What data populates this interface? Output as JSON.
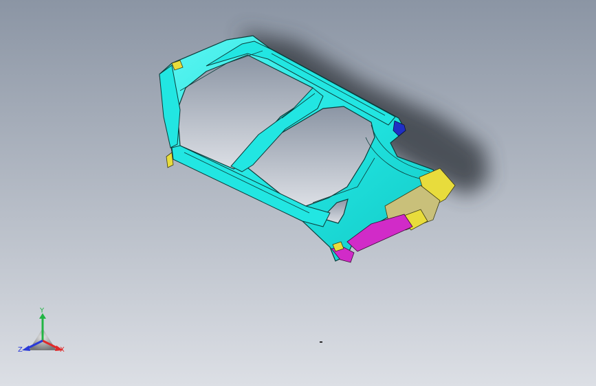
{
  "colors": {
    "background_top": "#8b95a4",
    "background_bottom": "#dcdfe5",
    "panel_primary": "#22e6e2",
    "panel_edge": "#0c3c3a",
    "part_yellow": "#e8dc3c",
    "part_magenta": "#d12bc8",
    "part_blue": "#1f2fc4",
    "part_olive": "#c9c07a",
    "shadow": "#3a3f47",
    "axis_x": "#e02a2a",
    "axis_y": "#22b544",
    "axis_z": "#2a3ad8"
  },
  "triad": {
    "label_x": "X",
    "label_y": "Y",
    "label_z": "Z"
  },
  "icons": {
    "triad": "coordinate-triad-icon",
    "cursor": "cursor-mark-icon"
  }
}
